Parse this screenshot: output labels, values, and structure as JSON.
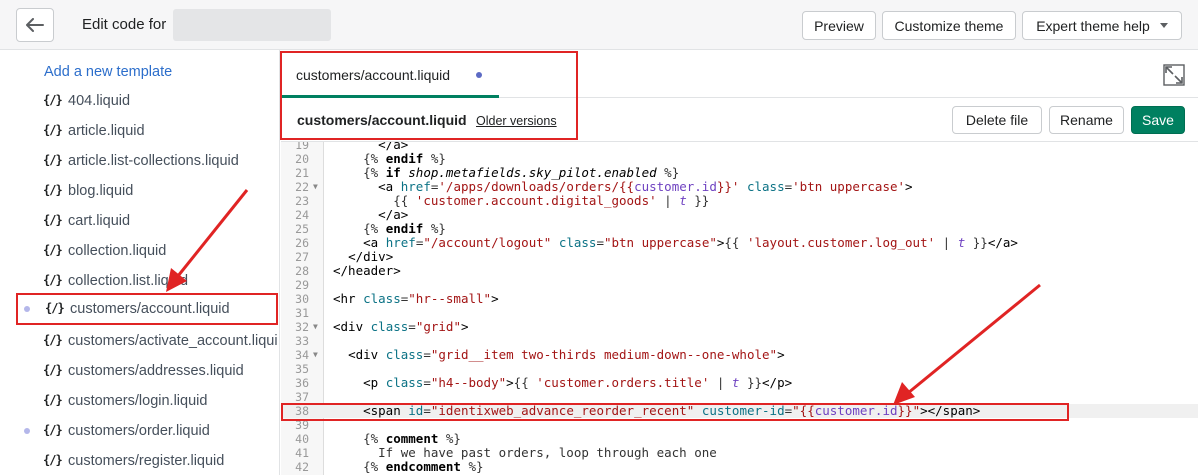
{
  "header": {
    "title": "Edit code for",
    "back_icon": "arrow-left-icon",
    "buttons": {
      "preview": "Preview",
      "customize": "Customize theme",
      "expert": "Expert theme help"
    }
  },
  "sidebar": {
    "add_template": "Add a new template",
    "file_icon_glyph": "{/}",
    "items": [
      {
        "label": "404.liquid",
        "dot": false
      },
      {
        "label": "article.liquid",
        "dot": false
      },
      {
        "label": "article.list-collections.liquid",
        "dot": false
      },
      {
        "label": "blog.liquid",
        "dot": false
      },
      {
        "label": "cart.liquid",
        "dot": false
      },
      {
        "label": "collection.liquid",
        "dot": false
      },
      {
        "label": "collection.list.liquid",
        "dot": false
      },
      {
        "label": "customers/account.liquid",
        "dot": true
      },
      {
        "label": "customers/activate_account.liquid",
        "dot": false
      },
      {
        "label": "customers/addresses.liquid",
        "dot": false
      },
      {
        "label": "customers/login.liquid",
        "dot": false
      },
      {
        "label": "customers/order.liquid",
        "dot": true
      },
      {
        "label": "customers/register.liquid",
        "dot": false
      }
    ]
  },
  "editor": {
    "tab_label": "customers/account.liquid",
    "file_title": "customers/account.liquid",
    "older_versions": "Older versions",
    "buttons": {
      "delete": "Delete file",
      "rename": "Rename",
      "save": "Save"
    },
    "lines": [
      {
        "n": "19",
        "fold": false
      },
      {
        "n": "20",
        "fold": false
      },
      {
        "n": "21",
        "fold": false
      },
      {
        "n": "22",
        "fold": true
      },
      {
        "n": "23",
        "fold": false
      },
      {
        "n": "24",
        "fold": false
      },
      {
        "n": "25",
        "fold": false
      },
      {
        "n": "26",
        "fold": false
      },
      {
        "n": "27",
        "fold": false
      },
      {
        "n": "28",
        "fold": false
      },
      {
        "n": "29",
        "fold": false
      },
      {
        "n": "30",
        "fold": false
      },
      {
        "n": "31",
        "fold": false
      },
      {
        "n": "32",
        "fold": true
      },
      {
        "n": "33",
        "fold": false
      },
      {
        "n": "34",
        "fold": true
      },
      {
        "n": "35",
        "fold": false
      },
      {
        "n": "36",
        "fold": false
      },
      {
        "n": "37",
        "fold": false
      },
      {
        "n": "38",
        "fold": false
      },
      {
        "n": "39",
        "fold": false
      },
      {
        "n": "40",
        "fold": false
      },
      {
        "n": "41",
        "fold": false
      },
      {
        "n": "42",
        "fold": false
      }
    ]
  },
  "colors": {
    "accent": "#008060",
    "link": "#2c6ecb",
    "highlight": "#e02424"
  }
}
